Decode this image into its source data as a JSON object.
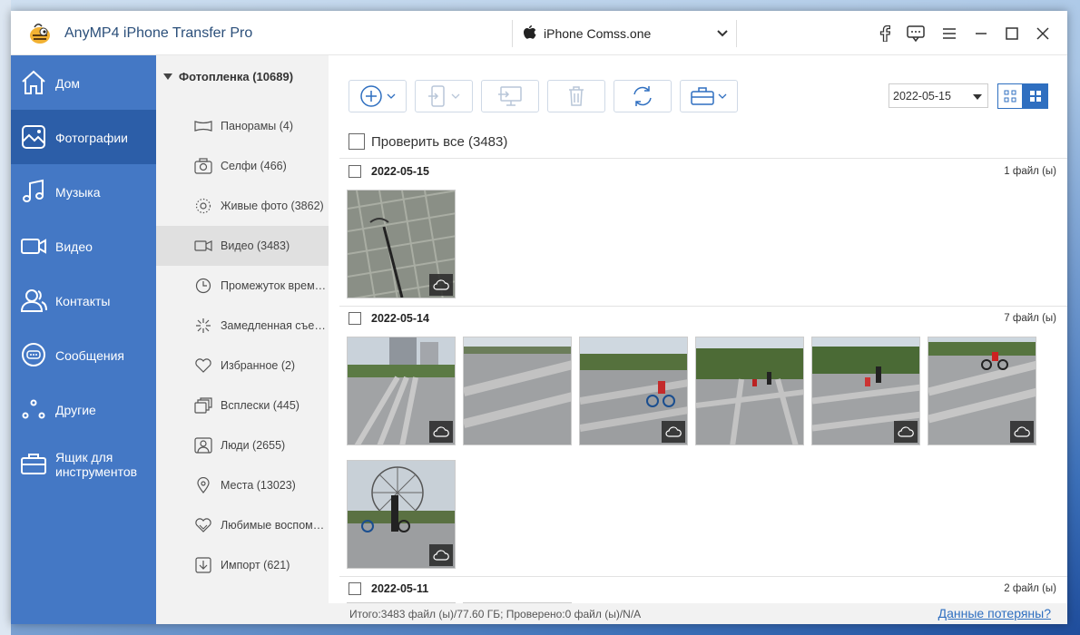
{
  "app": {
    "title": "AnyMP4 iPhone Transfer Pro"
  },
  "device": {
    "name": "iPhone Comss.one"
  },
  "titlebar_icons": [
    "facebook-icon",
    "feedback-icon",
    "menu-icon",
    "minimize-icon",
    "maximize-icon",
    "close-icon"
  ],
  "sidebar": {
    "items": [
      {
        "label": "Дом",
        "icon": "home-icon"
      },
      {
        "label": "Фотографии",
        "icon": "photos-icon",
        "active": true
      },
      {
        "label": "Музыка",
        "icon": "music-icon"
      },
      {
        "label": "Видео",
        "icon": "video-icon"
      },
      {
        "label": "Контакты",
        "icon": "contacts-icon"
      },
      {
        "label": "Сообщения",
        "icon": "messages-icon"
      },
      {
        "label": "Другие",
        "icon": "others-icon"
      },
      {
        "label": "Ящик для инструментов",
        "icon": "toolbox-icon"
      }
    ]
  },
  "tree": {
    "header": "Фотопленка (10689)",
    "items": [
      {
        "label": "Панорамы (4)",
        "icon": "panorama-icon"
      },
      {
        "label": "Селфи (466)",
        "icon": "selfie-icon"
      },
      {
        "label": "Живые фото (3862)",
        "icon": "live-photo-icon"
      },
      {
        "label": "Видео (3483)",
        "icon": "video-icon",
        "active": true
      },
      {
        "label": "Промежуток времени",
        "icon": "timelapse-icon"
      },
      {
        "label": "Замедленная съемка",
        "icon": "slowmo-icon"
      },
      {
        "label": "Избранное (2)",
        "icon": "heart-icon"
      },
      {
        "label": "Всплески (445)",
        "icon": "bursts-icon"
      },
      {
        "label": "Люди (2655)",
        "icon": "people-icon"
      },
      {
        "label": "Места (13023)",
        "icon": "places-icon"
      },
      {
        "label": "Любимые воспоминания",
        "icon": "memories-icon"
      },
      {
        "label": "Импорт (621)",
        "icon": "import-icon"
      }
    ]
  },
  "toolbar": {
    "date_value": "2022-05-15",
    "buttons": [
      "add-icon",
      "export-device-icon",
      "export-pc-icon",
      "delete-icon",
      "sync-icon",
      "toolbox-icon"
    ]
  },
  "main": {
    "check_all": "Проверить все (3483)",
    "groups": [
      {
        "date": "2022-05-15",
        "count": "1 файл (ы)"
      },
      {
        "date": "2022-05-14",
        "count": "7 файл (ы)"
      },
      {
        "date": "2022-05-11",
        "count": "2 файл (ы)"
      }
    ]
  },
  "status": {
    "summary": "Итого:3483 файл (ы)/77.60 ГБ; Проверено:0 файл (ы)/N/A",
    "link": "Данные потеряны?"
  },
  "colors": {
    "sidebar": "#4478c5",
    "sidebar_active": "#2c5ea8",
    "accent": "#2f6fc0"
  }
}
